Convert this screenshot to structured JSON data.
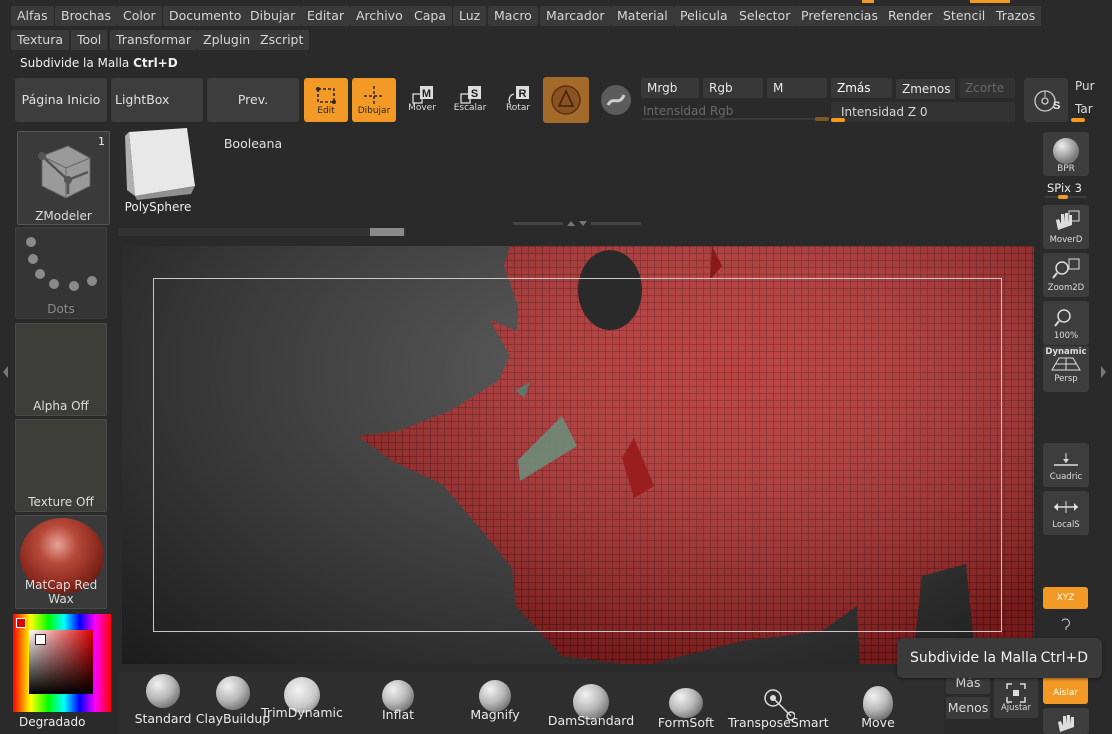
{
  "menu": [
    "Alfas",
    "Brochas",
    "Color",
    "Documento",
    "Dibujar",
    "Editar",
    "Archivo",
    "Capa",
    "Luz",
    "Macro",
    "Marcador",
    "Material",
    "Pelicula",
    "Selector",
    "Preferencias",
    "Render",
    "Stencil",
    "Trazos",
    "Textura",
    "Tool",
    "Transformar",
    "Zplugin",
    "Zscript"
  ],
  "status": {
    "action": "Subdivide la Malla",
    "shortcut": "Ctrl+D"
  },
  "toolbar": {
    "home": "Página Inicio",
    "lightbox": "LightBox",
    "boolean": "Prev. Booleana",
    "edit": "Edit",
    "draw": "Dibujar",
    "move": "Mover",
    "scale": "Escalar",
    "rotate": "Rotar",
    "mrgb": "Mrgb",
    "rgb": "Rgb",
    "m": "M",
    "zadd": "Zmás",
    "zsub": "Zmenos",
    "zcut": "Zcorte",
    "rgb_intensity": "Intensidad Rgb",
    "z_intensity_label": "Intensidad Z",
    "z_intensity_value": "0",
    "pur": "Pur",
    "tar": "Tar"
  },
  "left_panel": {
    "tool_name": "ZModeler",
    "tool_count": "1",
    "stroke": "Dots",
    "alpha": "Alpha Off",
    "texture": "Texture Off",
    "material": "MatCap Red Wax",
    "gradient": "Degradado"
  },
  "subtool": {
    "name": "PolySphere"
  },
  "right_panel": {
    "bpr": "BPR",
    "spix_label": "SPix",
    "spix_value": "3",
    "move2d": "MoverD",
    "zoom2d": "Zoom2D",
    "zoom100": "100%",
    "dynamic": "Dynamic",
    "persp": "Persp",
    "floor": "Cuadric",
    "local": "LocalS",
    "xyz": "XYZ",
    "isolate": "Aislar"
  },
  "bottom": {
    "more": "Más",
    "less": "Menos",
    "fit": "Ajustar",
    "brushes": [
      "Standard",
      "ClayBuildup",
      "TrimDynamic",
      "Inflat",
      "Magnify",
      "DamStandard",
      "FormSoft",
      "TransposeSmart",
      "Move"
    ]
  },
  "tooltip": {
    "text": "Subdivide la Malla",
    "shortcut": "Ctrl+D"
  },
  "colors": {
    "accent": "#f39a26",
    "mesh": "#b82b2b"
  }
}
